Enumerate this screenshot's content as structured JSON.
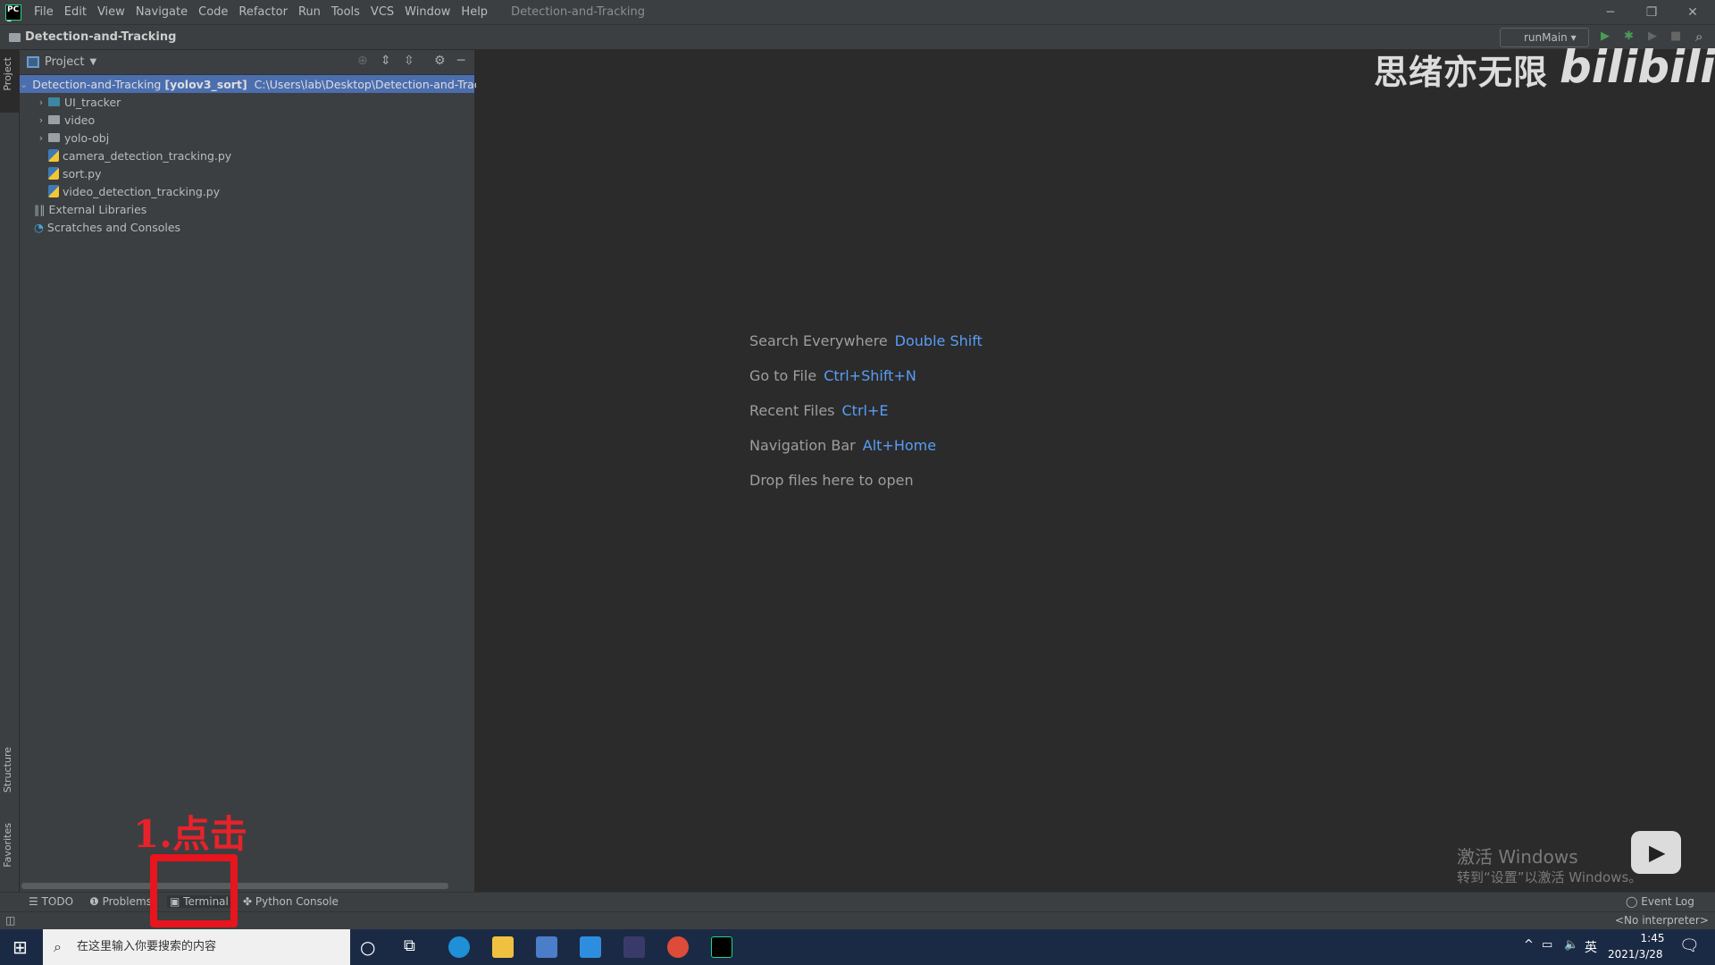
{
  "titlebar": {
    "menu": [
      "File",
      "Edit",
      "View",
      "Navigate",
      "Code",
      "Refactor",
      "Run",
      "Tools",
      "VCS",
      "Window",
      "Help"
    ],
    "window_title": "Detection-and-Tracking",
    "controls": [
      "minimize",
      "restore",
      "close"
    ]
  },
  "navbar": {
    "breadcrumb": "Detection-and-Tracking",
    "run_config": "runMain"
  },
  "stripe": {
    "project": "Project",
    "structure": "Structure",
    "favorites": "Favorites"
  },
  "project": {
    "title": "Project",
    "root": {
      "name": "Detection-and-Tracking",
      "env": "[yolov3_sort]",
      "path": "C:\\Users\\lab\\Desktop\\Detection-and-Tracking"
    },
    "items": [
      {
        "label": "UI_tracker",
        "type": "folder"
      },
      {
        "label": "video",
        "type": "folder"
      },
      {
        "label": "yolo-obj",
        "type": "folder"
      },
      {
        "label": "camera_detection_tracking.py",
        "type": "python"
      },
      {
        "label": "sort.py",
        "type": "python"
      },
      {
        "label": "video_detection_tracking.py",
        "type": "python"
      }
    ],
    "external": "External Libraries",
    "scratches": "Scratches and Consoles"
  },
  "editor": {
    "hints": [
      {
        "label": "Search Everywhere",
        "key": "Double Shift"
      },
      {
        "label": "Go to File",
        "key": "Ctrl+Shift+N"
      },
      {
        "label": "Recent Files",
        "key": "Ctrl+E"
      },
      {
        "label": "Navigation Bar",
        "key": "Alt+Home"
      }
    ],
    "drop": "Drop files here to open"
  },
  "toolwindows": {
    "todo": "TODO",
    "problems": "Problems",
    "terminal": "Terminal",
    "python_console": "Python Console",
    "event_log": "Event Log"
  },
  "status": {
    "interpreter": "<No interpreter>"
  },
  "taskbar": {
    "search_placeholder": "在这里输入你要搜索的内容",
    "time": "1:45",
    "date": "2021/3/28",
    "ime": "英"
  },
  "overlay": {
    "annotation": "1.点击",
    "watermark": "思绪亦无限",
    "bilibili": "bilibili",
    "activate_title": "激活 Windows",
    "activate_sub": "转到“设置”以激活 Windows。",
    "accent": "#e8141e"
  }
}
